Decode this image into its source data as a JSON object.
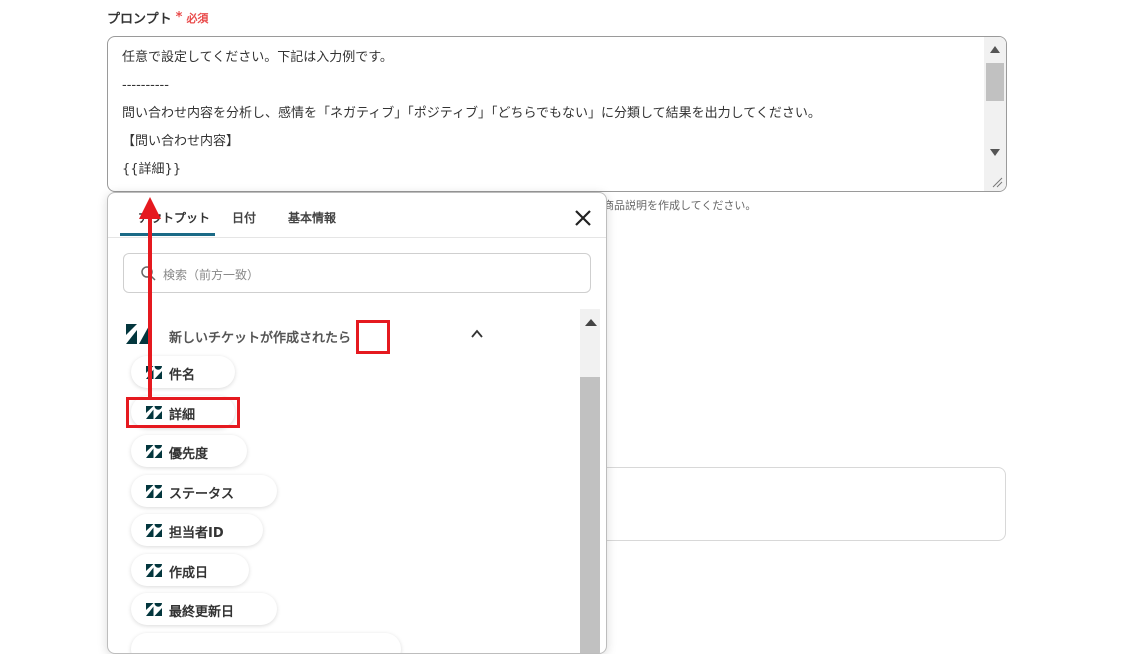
{
  "field": {
    "label": "プロンプト",
    "required_mark": "*",
    "required_text": "必須"
  },
  "prompt": {
    "lines": [
      "任意で設定してください。下記は入力例です。",
      "----------",
      "問い合わせ内容を分析し、感情を「ネガティブ」「ポジティブ」「どちらでもない」に分類して結果を出力してください。",
      "【問い合わせ内容】",
      "{{詳細}}"
    ]
  },
  "hint_text": "商品説明を作成してください。",
  "popup": {
    "tabs": [
      {
        "label": "アウトプット"
      },
      {
        "label": "日付"
      },
      {
        "label": "基本情報"
      }
    ],
    "search_placeholder": "検索（前方一致）",
    "group_title": "新しいチケットが作成されたら",
    "items": [
      {
        "label": "件名"
      },
      {
        "label": "詳細"
      },
      {
        "label": "優先度"
      },
      {
        "label": "ステータス"
      },
      {
        "label": "担当者ID"
      },
      {
        "label": "作成日"
      },
      {
        "label": "最終更新日"
      }
    ]
  },
  "colors": {
    "required": "#e94b4b",
    "tab_active": "#1b6a86",
    "highlight": "#e5191f",
    "zendesk_logo": "#03363d"
  }
}
